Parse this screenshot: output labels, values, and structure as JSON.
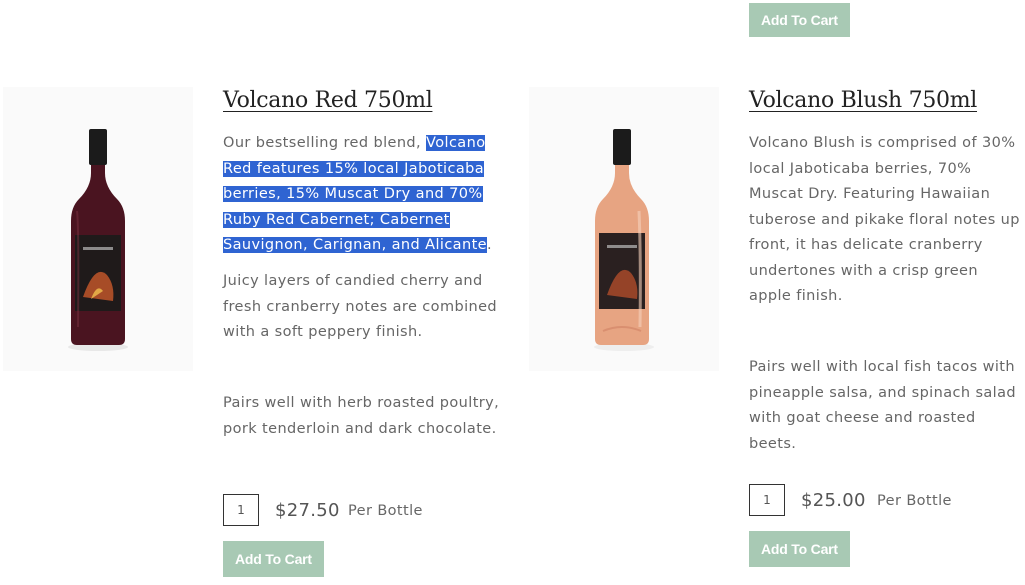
{
  "top_cart_label": "Add To Cart",
  "products": [
    {
      "title": "Volcano Red 750ml",
      "desc_plain": "Our bestselling red blend, ",
      "desc_selected": "Volcano Red features 15% local Jaboticaba berries, 15% Muscat Dry and 70% Ruby Red Cabernet; Cabernet Sauvignon, Carignan, and Alicante",
      "desc_end": ".",
      "para2": "Juicy layers of candied cherry and fresh cranberry notes are combined with a soft peppery finish.",
      "pairs": "Pairs well with herb roasted poultry, pork tenderloin and dark chocolate.",
      "qty": "1",
      "price": "$27.50",
      "per": "Per Bottle",
      "cart_label": "Add To Cart",
      "wine_color": "#4a1420"
    },
    {
      "title": "Volcano Blush 750ml",
      "para1": "Volcano Blush is comprised of 30% local Jaboticaba berries, 70% Muscat Dry.  Featuring Hawaiian tuberose and pikake floral notes up front, it has delicate cranberry undertones with a crisp green apple finish.",
      "pairs": "Pairs well with local fish tacos with pineapple salsa, and spinach salad with goat cheese and roasted beets.",
      "qty": "1",
      "price": "$25.00",
      "per": "Per Bottle",
      "cart_label": "Add To Cart",
      "wine_color": "#e7a482"
    }
  ],
  "colors": {
    "button": "#a8c9b4",
    "selection": "#2f64d2",
    "title": "#222222"
  }
}
